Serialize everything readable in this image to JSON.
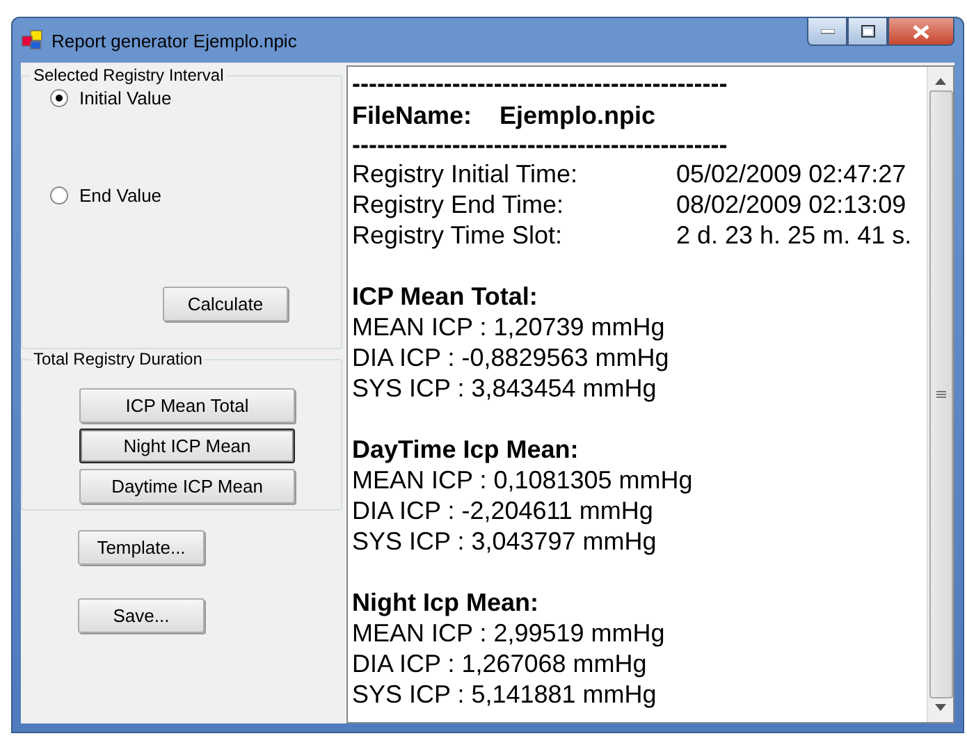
{
  "window": {
    "title": "Report generator Ejemplo.npic"
  },
  "interval_group": {
    "title": "Selected Registry Interval",
    "options": [
      {
        "label": "Initial Value",
        "selected": true
      },
      {
        "label": "End Value",
        "selected": false
      }
    ],
    "calculate": "Calculate"
  },
  "duration_group": {
    "title": "Total Registry Duration",
    "buttons": [
      {
        "label": "ICP Mean Total",
        "focused": false
      },
      {
        "label": "Night ICP Mean",
        "focused": true
      },
      {
        "label": "Daytime ICP Mean",
        "focused": false
      }
    ]
  },
  "actions": [
    "Template...",
    "Save..."
  ],
  "report": [
    {
      "kind": "separator",
      "text": "---------------------------------------------"
    },
    {
      "kind": "title",
      "label": "FileName:",
      "value": "Ejemplo.npic"
    },
    {
      "kind": "separator",
      "text": "---------------------------------------------"
    },
    {
      "kind": "pair",
      "label": "Registry Initial Time:",
      "value": "05/02/2009 02:47:27"
    },
    {
      "kind": "pair",
      "label": "Registry End Time:",
      "value": "08/02/2009 02:13:09"
    },
    {
      "kind": "pair",
      "label": "Registry Time Slot:",
      "value": "2 d. 23 h. 25 m. 41 s."
    },
    {
      "kind": "blank"
    },
    {
      "kind": "heading",
      "text": "ICP Mean Total:"
    },
    {
      "kind": "line",
      "text": "MEAN ICP : 1,20739 mmHg"
    },
    {
      "kind": "line",
      "text": "DIA ICP : -0,8829563 mmHg"
    },
    {
      "kind": "line",
      "text": "SYS ICP : 3,843454 mmHg"
    },
    {
      "kind": "blank"
    },
    {
      "kind": "heading",
      "text": "DayTime Icp Mean:"
    },
    {
      "kind": "line",
      "text": "MEAN ICP : 0,1081305 mmHg"
    },
    {
      "kind": "line",
      "text": "DIA ICP : -2,204611 mmHg"
    },
    {
      "kind": "line",
      "text": "SYS ICP : 3,043797 mmHg"
    },
    {
      "kind": "blank"
    },
    {
      "kind": "heading",
      "text": "Night Icp Mean:"
    },
    {
      "kind": "line",
      "text": "MEAN ICP : 2,99519 mmHg"
    },
    {
      "kind": "line",
      "text": "DIA ICP : 1,267068 mmHg"
    },
    {
      "kind": "line",
      "text": "SYS ICP : 5,141881 mmHg"
    }
  ]
}
